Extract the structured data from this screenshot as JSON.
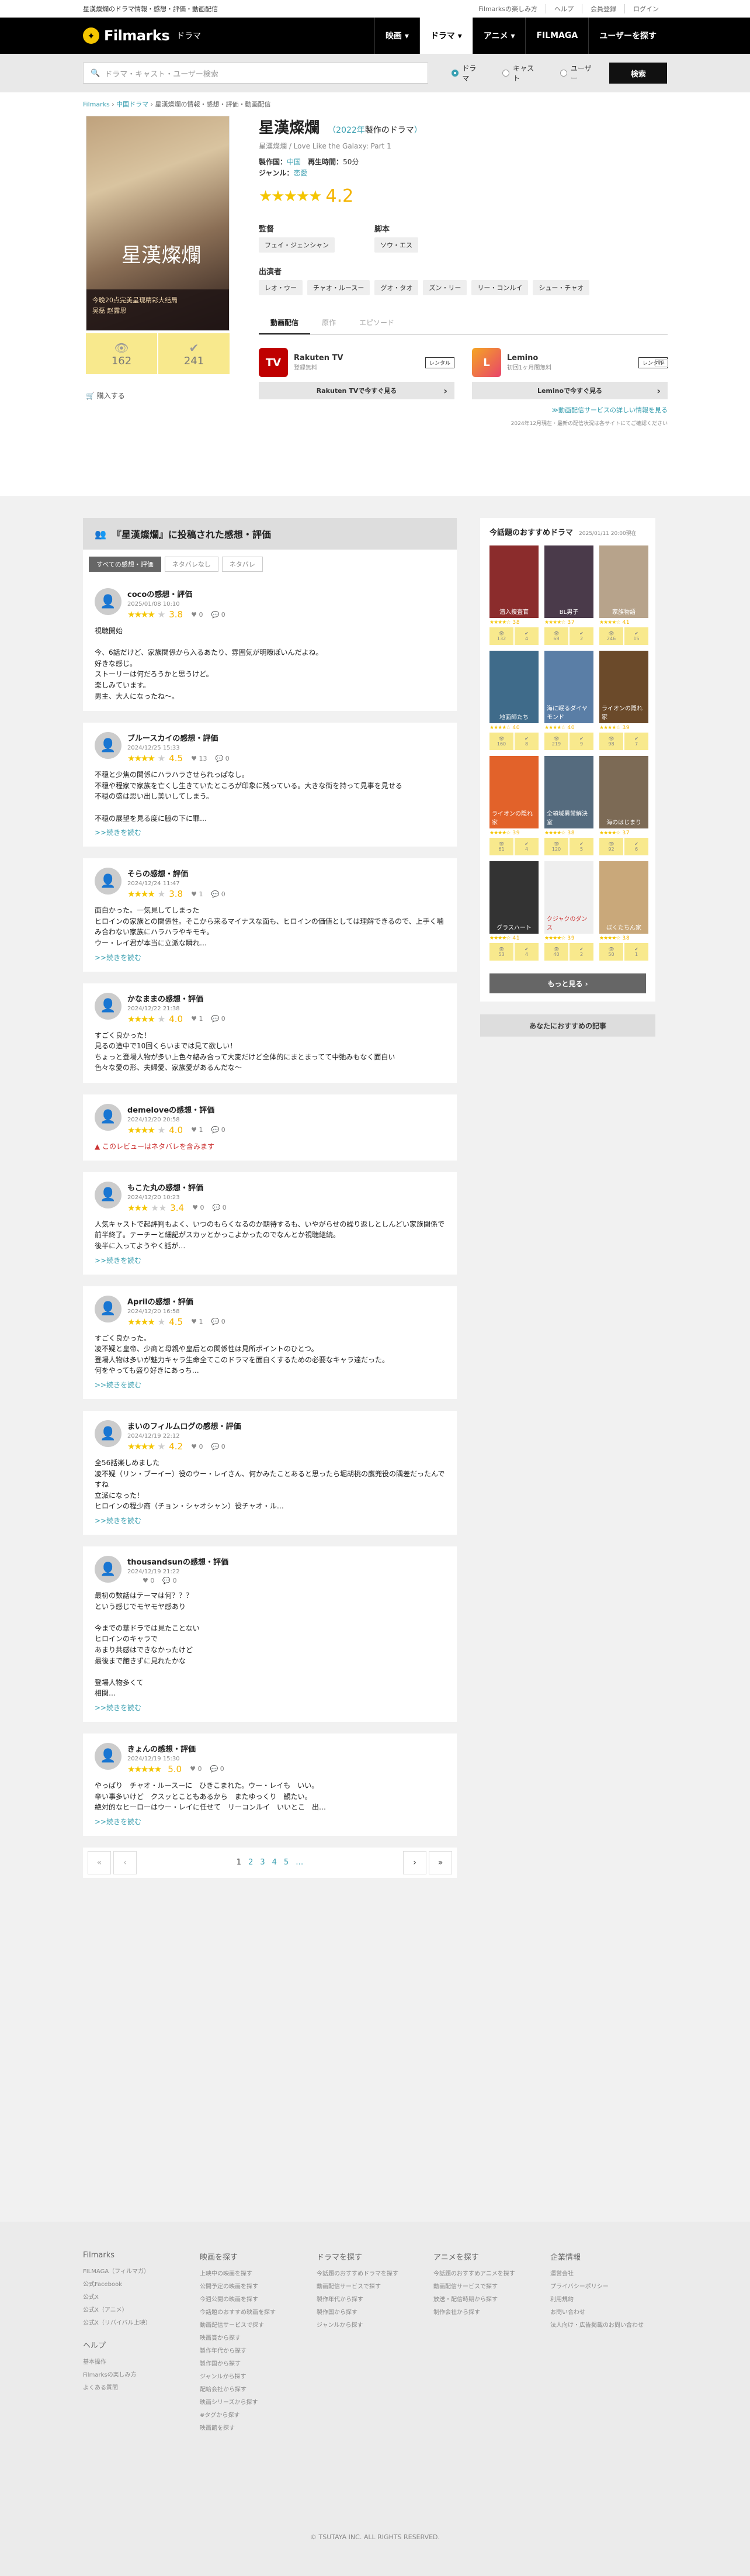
{
  "topbar": {
    "tagline": "星漢燦爛のドラマ情報・感想・評価・動画配信",
    "links": [
      "Filmarksの楽しみ方",
      "ヘルプ",
      "会員登録",
      "ログイン"
    ]
  },
  "header": {
    "logo": "Filmarks",
    "logo_small": "フィルマークス",
    "section": "ドラマ",
    "nav": [
      "映画 ▾",
      "ドラマ ▾",
      "アニメ ▾",
      "FILMAGA",
      "ユーザーを探す"
    ]
  },
  "search": {
    "placeholder": "ドラマ・キャスト・ユーザー検索",
    "options": [
      "ドラマ",
      "キャスト",
      "ユーザー"
    ],
    "button": "検索"
  },
  "breadcrumb": [
    "Filmarks",
    "中国ドラマ",
    "星漢燦爛の情報・感想・評価・動画配信"
  ],
  "poster": {
    "title": "星漢燦爛",
    "caption": "今晚20点完美呈现精彩大结局\n吴磊 赵露思"
  },
  "clips": [
    {
      "icon": "eye-icon",
      "count": "162"
    },
    {
      "icon": "check-icon",
      "count": "241"
    }
  ],
  "buy": "購入する",
  "drama": {
    "title": "星漢燦爛",
    "year_link": "2022年",
    "year_suffix": "製作のドラマ",
    "original": "星漢燦爛 / Love Like the Galaxy: Part 1",
    "producer_label": "製作国：",
    "producer": "中国",
    "runtime_label": "再生時間：",
    "runtime": "50分",
    "genre_label": "ジャンル：",
    "genre": "恋愛",
    "stars": "★★★★★",
    "score": "4.2"
  },
  "crew": {
    "director_label": "監督",
    "director": "フェイ・ジェンシャン",
    "writer_label": "脚本",
    "writer": "ソウ・エス",
    "cast_label": "出演者",
    "cast": [
      "レオ・ウー",
      "チャオ・ルースー",
      "グオ・タオ",
      "ズン・リー",
      "リー・コンルイ",
      "シュー・チャオ"
    ]
  },
  "tabs": [
    "動画配信",
    "原作",
    "エピソード"
  ],
  "note": "PR",
  "services": [
    {
      "name": "Rakuten TV",
      "sub": "登録無料",
      "badge": "レンタル",
      "logo": "TV",
      "button": "Rakuten TVで今すぐ見る",
      "color": "#bf0000"
    },
    {
      "name": "Lemino",
      "sub": "初回1ヶ月間無料",
      "badge": "レンタル",
      "logo": "L",
      "button": "Leminoで今すぐ見る",
      "color": "#e8446b"
    }
  ],
  "more_services": "≫動画配信サービスの詳しい情報を見る",
  "disclaimer": "2024年12月現在・最新の配信状況は各サイトにてご確認ください",
  "reviews_header": "『星漢燦爛』に投稿された感想・評価",
  "filters": [
    "すべての感想・評価",
    "ネタバレなし",
    "ネタバレ"
  ],
  "reviews": [
    {
      "name": "cocoの感想・評価",
      "date": "2025/01/08 10:10",
      "stars": "★★★★",
      "gstars": "★",
      "score": "3.8",
      "likes": "0",
      "comments": "0",
      "body": "視聴開始\n\n今、6話だけど、家族関係から入るあたり、雰囲気が明瞭ぽいんだよね。\n好きな感じ。\nストーリーは何だろうかと思うけど。\n楽しみています。\n男主、大人になったね〜。",
      "more": "",
      "spoiler": ""
    },
    {
      "name": "ブルースカイの感想・評価",
      "date": "2024/12/25 15:33",
      "stars": "★★★★",
      "gstars": "★",
      "score": "4.5",
      "likes": "13",
      "comments": "0",
      "body": "不穏と少焦の関係にハラハラさせられっぱなし。\n不穏や程家で家族を亡くし生きていたところが印象に残っている。大きな街を持って見事を見せる\n不穏の盛は思い出し美いしてしまう。\n\n不穏の展望を見る度に脇の下に罪…",
      "more": ">>続きを読む",
      "spoiler": ""
    },
    {
      "name": "そらの感想・評価",
      "date": "2024/12/24 11:47",
      "stars": "★★★★",
      "gstars": "★",
      "score": "3.8",
      "likes": "1",
      "comments": "0",
      "body": "面白かった。一気見してしまった\nヒロインの家族との関係性。そこから来るマイナスな面も、ヒロインの価値としては理解できるので、上手く噛み合わない家族にハラハラやキモキ。\nウー・レイ君が本当に立派な瞬れ…",
      "more": ">>続きを読む",
      "spoiler": ""
    },
    {
      "name": "かなままの感想・評価",
      "date": "2024/12/22 21:38",
      "stars": "★★★★",
      "gstars": "★",
      "score": "4.0",
      "likes": "1",
      "comments": "0",
      "body": "すごく良かった！\n見るの途中で10回くらいまでは見て欲しい！\nちょっと登場人物が多い上色々絡み合って大変だけど全体的にまとまってて中弛みもなく面白い\n色々な愛の形、夫婦愛、家族愛があるんだな〜",
      "more": "",
      "spoiler": ""
    },
    {
      "name": "demeloveの感想・評価",
      "date": "2024/12/20 20:58",
      "stars": "★★★★",
      "gstars": "★",
      "score": "4.0",
      "likes": "1",
      "comments": "0",
      "body": "",
      "more": "",
      "spoiler": "▲ このレビューはネタバレを含みます"
    },
    {
      "name": "もこた丸の感想・評価",
      "date": "2024/12/20 10:23",
      "stars": "★★★",
      "gstars": "★★",
      "score": "3.4",
      "likes": "0",
      "comments": "0",
      "body": "人気キャストで起評判もよく、いつのもらくなるのか期待するも、いやがらせの繰り返しとしんどい家族関係で前半終了。テーチーと細記がスカッとかっこよかったのでなんとか視聴継続。\n後半に入ってようやく話が…",
      "more": ">>続きを読む",
      "spoiler": ""
    },
    {
      "name": "Aprilの感想・評価",
      "date": "2024/12/20 16:58",
      "stars": "★★★★",
      "gstars": "★",
      "score": "4.5",
      "likes": "1",
      "comments": "0",
      "body": "すごく良かった。\n凌不疑と皇帝、少商と母親や皇后との関係性は見所ポイントのひとつ。\n登場人物は多いが魅力キャラ生命全てこのドラマを面白くするための必要なキャラ達だった。\n何をやっても盛り好きにあっち…",
      "more": ">>続きを読む",
      "spoiler": ""
    },
    {
      "name": "まいのフィルムログの感想・評価",
      "date": "2024/12/19 22:12",
      "stars": "★★★★",
      "gstars": "★",
      "score": "4.2",
      "likes": "0",
      "comments": "0",
      "body": "全56話楽しめました\n凌不疑（リン・ブーイー）役のウー・レイさん、何かみたことあると思ったら堀胡桃の鷹兜役の隅差だったんですね\n立派になった！\nヒロインの程少商（チョン・シャオシャン）役チャオ・ル…",
      "more": ">>続きを読む",
      "spoiler": ""
    },
    {
      "name": "thousandsunの感想・評価",
      "date": "2024/12/19 21:22",
      "stars": "",
      "gstars": "",
      "score": "",
      "likes": "0",
      "comments": "0",
      "body": "最初の数話はテーマは何？？？\nという感じでモヤモヤ感あり\n\n今までの華ドラでは見たことない\nヒロインのキャラで\nあまり共感はできなかったけど\n最後まで飽きずに見れたかな\n\n登場人物多くて\n相関…",
      "more": ">>続きを読む",
      "spoiler": ""
    },
    {
      "name": "きょんの感想・評価",
      "date": "2024/12/19 15:30",
      "stars": "★★★★★",
      "gstars": "",
      "score": "5.0",
      "likes": "0",
      "comments": "0",
      "body": "やっぱり　チャオ・ルースーに　ひきこまれた。ウー・レイも　いい。\n辛い事多いけど　クスッとこともあるから　またゆっくり　観たい。\n絶対的なヒーローはウー・レイに任せて　リーコンルイ　いいとこ　出…",
      "more": ">>続きを読む",
      "spoiler": ""
    }
  ],
  "pager": {
    "first": "«",
    "prev": "‹",
    "pages": [
      "1",
      "2",
      "3",
      "4",
      "5",
      "…"
    ],
    "next": "›",
    "last": "»"
  },
  "sidebar": {
    "title": "今話題のおすすめドラマ",
    "updated": "2025/01/11 20:00現在",
    "more": "もっと見る ›",
    "articles": "あなたにおすすめの記事",
    "items": [
      {
        "color": "#8b2c2c",
        "label": "潜入捜査官",
        "score": "3.8",
        "c1": "132",
        "c2": "4"
      },
      {
        "color": "#4a3a4a",
        "label": "BL男子",
        "score": "3.7",
        "c1": "68",
        "c2": "2"
      },
      {
        "color": "#b7a38b",
        "label": "家族物語",
        "score": "4.1",
        "c1": "246",
        "c2": "15"
      },
      {
        "color": "#3f6b8a",
        "label": "地面師たち",
        "score": "4.0",
        "c1": "160",
        "c2": "8"
      },
      {
        "color": "#5a7ea6",
        "label": "海に眠るダイヤモンド",
        "score": "4.0",
        "c1": "219",
        "c2": "9"
      },
      {
        "color": "#6b4a2a",
        "label": "ライオンの隠れ家",
        "score": "3.9",
        "c1": "98",
        "c2": "7"
      },
      {
        "color": "#e2622a",
        "label": "ライオンの隠れ家",
        "score": "3.9",
        "c1": "61",
        "c2": "4"
      },
      {
        "color": "#556b7e",
        "label": "全領域異常解決室",
        "score": "3.8",
        "c1": "120",
        "c2": "5"
      },
      {
        "color": "#7c6a55",
        "label": "海のはじまり",
        "score": "3.7",
        "c1": "92",
        "c2": "6"
      },
      {
        "color": "#333333",
        "label": "グラスハート",
        "score": "4.1",
        "c1": "53",
        "c2": "4"
      },
      {
        "color": "#eeeeee",
        "label": "クジャクのダンス",
        "score": "3.9",
        "c1": "40",
        "c2": "2"
      },
      {
        "color": "#c9a87a",
        "label": "ぼくたちん家",
        "score": "3.8",
        "c1": "50",
        "c2": "1"
      }
    ]
  },
  "footer": {
    "cols": [
      {
        "title": "Filmarks",
        "links": [
          "FILMAGA（フィルマガ）",
          "公式Facebook",
          "公式X",
          "公式X（アニメ）",
          "公式X（リバイバル上映）"
        ],
        "title2": "ヘルプ",
        "links2": [
          "基本操作",
          "Filmarksの楽しみ方",
          "よくある質問"
        ]
      },
      {
        "title": "映画を探す",
        "links": [
          "上映中の映画を探す",
          "公開予定の映画を探す",
          "今週公開の映画を探す",
          "今話題のおすすめ映画を探す",
          "動画配信サービスで探す",
          "映画賞から探す",
          "製作年代から探す",
          "製作国から探す",
          "ジャンルから探す",
          "配給会社から探す",
          "映画シリーズから探す",
          "#タグから探す",
          "映画館を探す"
        ]
      },
      {
        "title": "ドラマを探す",
        "links": [
          "今話題のおすすめドラマを探す",
          "動画配信サービスで探す",
          "製作年代から探す",
          "製作国から探す",
          "ジャンルから探す"
        ]
      },
      {
        "title": "アニメを探す",
        "links": [
          "今話題のおすすめアニメを探す",
          "動画配信サービスで探す",
          "放送・配信時期から探す",
          "制作会社から探す"
        ]
      },
      {
        "title": "企業情報",
        "links": [
          "運営会社",
          "プライバシーポリシー",
          "利用規約",
          "お問い合わせ",
          "法人向け・広告掲載のお問い合わせ"
        ]
      }
    ],
    "copyright": "© TSUTAYA INC. ALL RIGHTS RESERVED."
  }
}
